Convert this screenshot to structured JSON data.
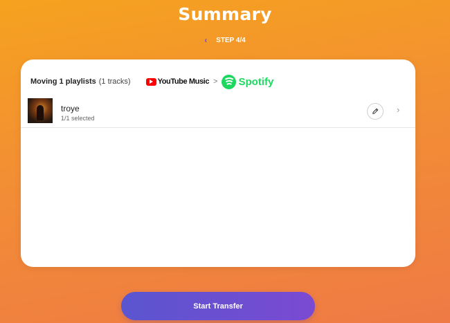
{
  "page": {
    "title": "Summary"
  },
  "step": {
    "back_icon": "chevron-left-icon",
    "label": "STEP 4/4"
  },
  "summary": {
    "moving_label": "Moving 1 playlists",
    "tracks_label": "(1 tracks)",
    "source": {
      "name": "YouTube Music",
      "icon": "youtube-music-logo"
    },
    "separator": ">",
    "destination": {
      "name": "Spotify",
      "icon": "spotify-logo"
    }
  },
  "playlists": [
    {
      "name": "troye",
      "selected": "1/1 selected"
    }
  ],
  "actions": {
    "start_transfer": "Start Transfer"
  },
  "colors": {
    "background_top": "#f6a21f",
    "background_bottom": "#ef7a45",
    "accent": "#6a4fd6",
    "spotify_green": "#1ed760",
    "youtube_red": "#ff0000"
  }
}
